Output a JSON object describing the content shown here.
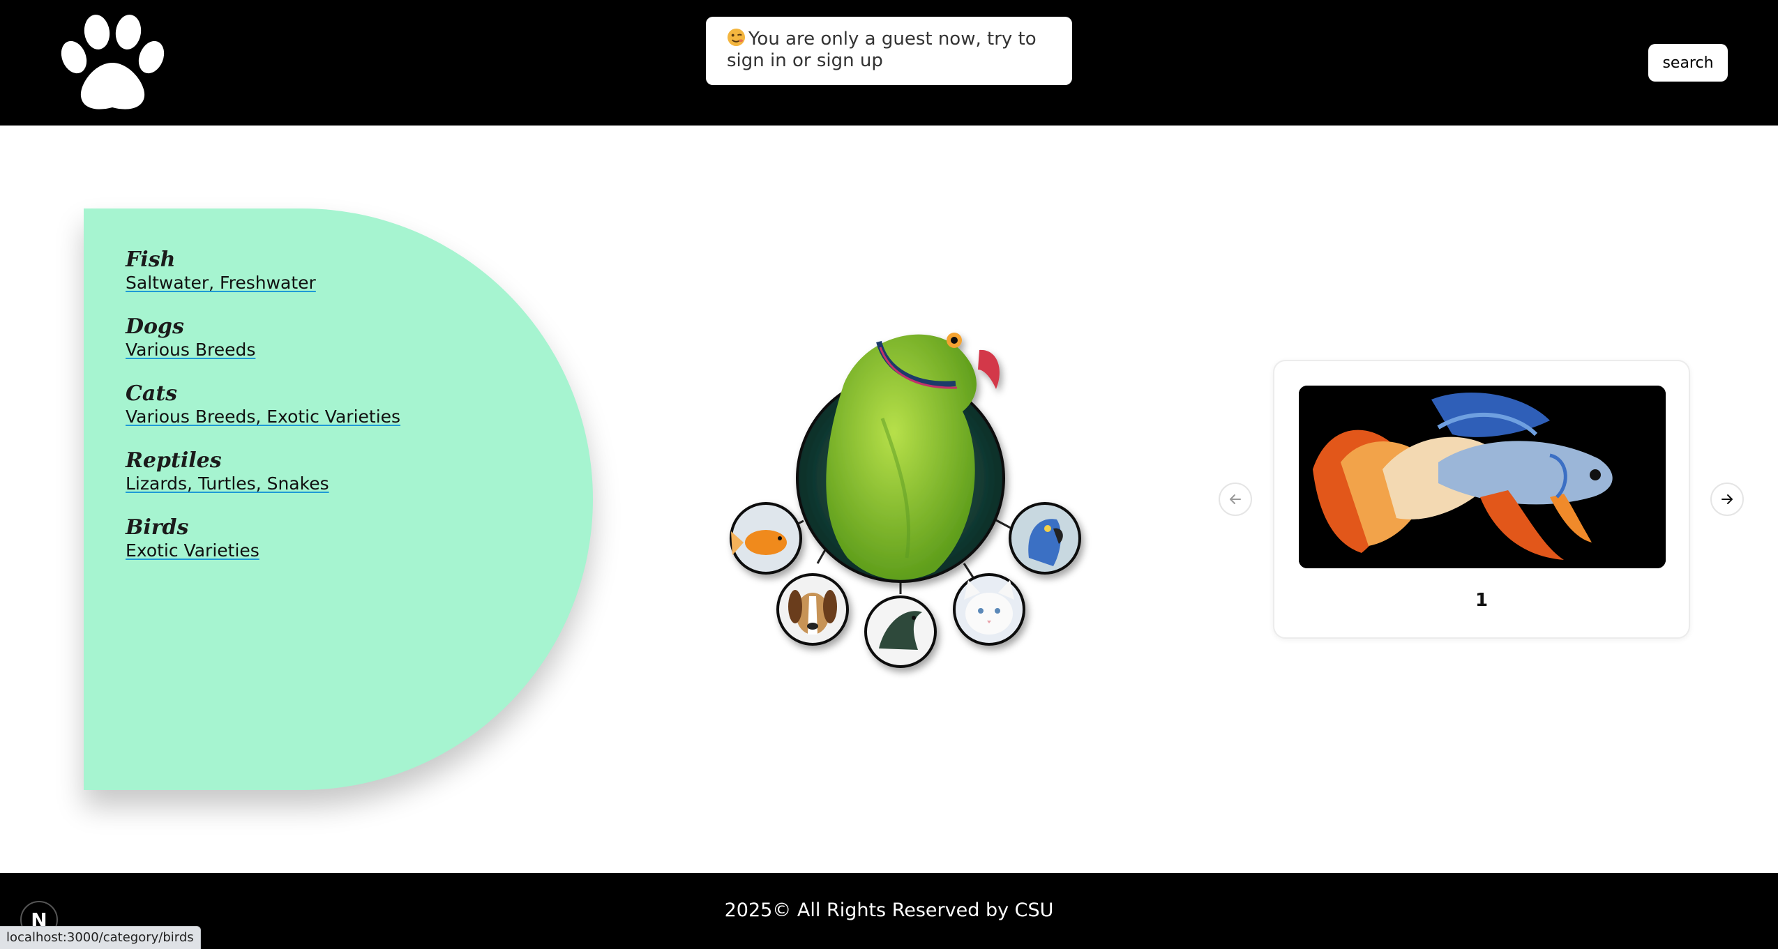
{
  "header": {
    "guest_message": "You are only a guest now, try to sign in or sign up",
    "search_label": "search"
  },
  "categories": [
    {
      "title": "Fish",
      "subtitle": "Saltwater, Freshwater"
    },
    {
      "title": "Dogs",
      "subtitle": "Various Breeds"
    },
    {
      "title": "Cats",
      "subtitle": "Various Breeds, Exotic Varieties"
    },
    {
      "title": "Reptiles",
      "subtitle": "Lizards, Turtles, Snakes"
    },
    {
      "title": "Birds",
      "subtitle": "Exotic Varieties"
    }
  ],
  "carousel": {
    "current_slide": "1"
  },
  "footer": {
    "copyright": "2025© All Rights Reserved by CSU"
  },
  "dev_badge": {
    "letter": "N"
  },
  "status_bar": {
    "url": "localhost:3000/category/birds"
  },
  "colors": {
    "header_bg": "#000000",
    "panel_bg": "#a6f4d0",
    "link_underline": "#1e9ad6"
  }
}
